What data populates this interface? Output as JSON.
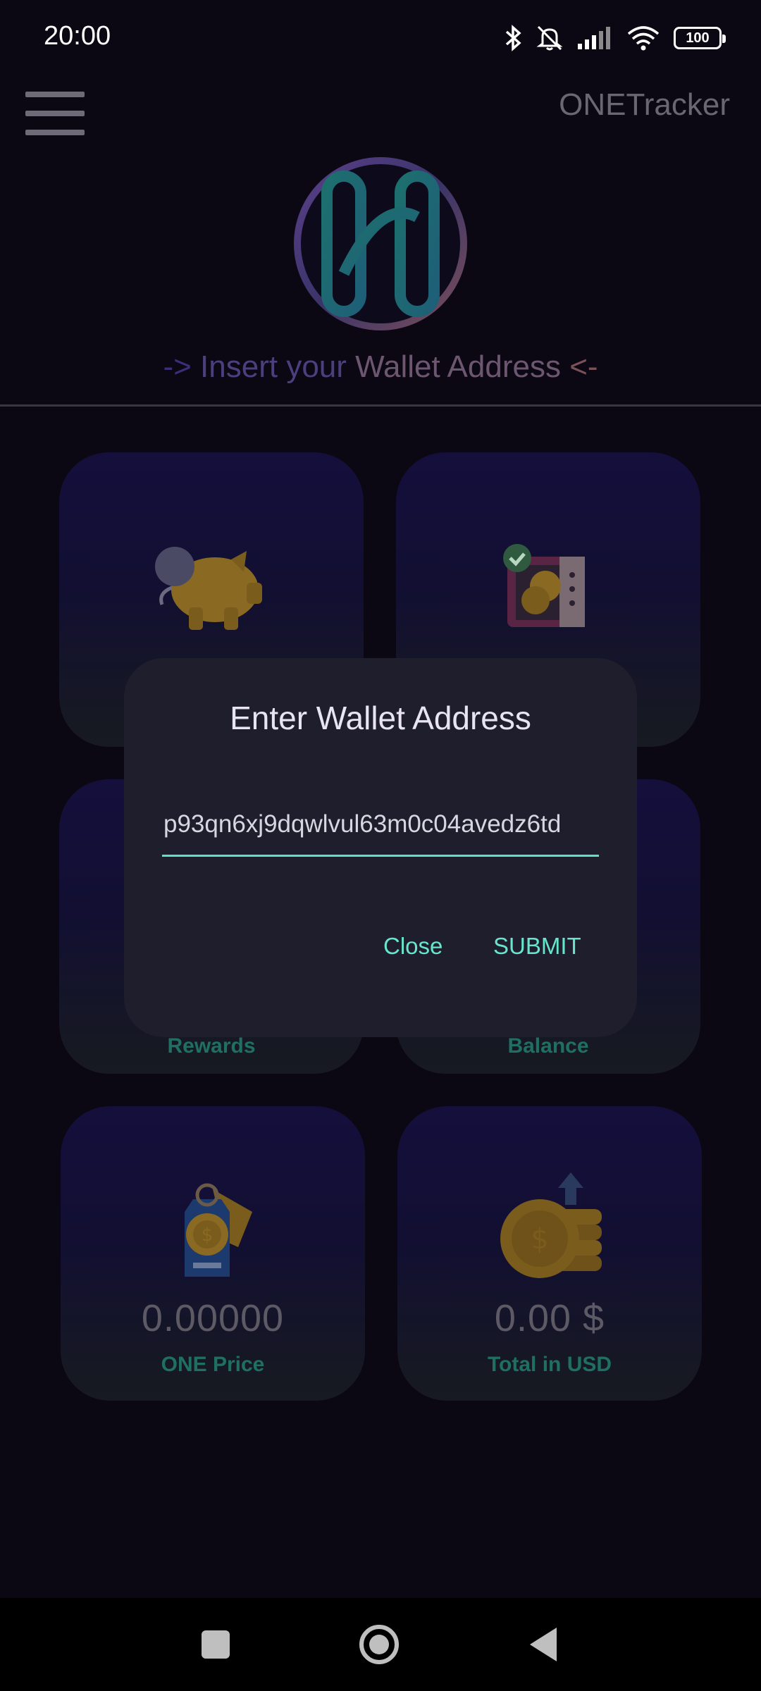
{
  "status_bar": {
    "time": "20:00",
    "battery": "100",
    "icons": [
      "bluetooth-icon",
      "bell-muted-icon",
      "signal-icon",
      "wifi-icon",
      "battery-icon"
    ]
  },
  "header": {
    "title": "ONETracker",
    "menu_icon": "hamburger-menu-icon"
  },
  "hint": {
    "arrow_left": "->",
    "insert": "Insert",
    "your": "your",
    "wallet_address": "Wallet Address",
    "arrow_right": "<-"
  },
  "cards": [
    {
      "icon": "piggy-bank-icon",
      "label": ""
    },
    {
      "icon": "safe-coins-icon",
      "label": ""
    },
    {
      "icon": "",
      "label": "Rewards"
    },
    {
      "icon": "",
      "label": "Balance"
    },
    {
      "icon": "price-tag-icon",
      "value": "0.00000",
      "label": "ONE Price"
    },
    {
      "icon": "coin-stack-icon",
      "value": "0.00 $",
      "label": "Total in USD"
    }
  ],
  "dialog": {
    "title": "Enter Wallet Address",
    "input_value": "p93qn6xj9dqwlvul63m0c04avedz6td",
    "close_label": "Close",
    "submit_label": "SUBMIT"
  },
  "nav_bar": {
    "icons": [
      "recents-square-icon",
      "home-circle-icon",
      "back-triangle-icon"
    ]
  },
  "colors": {
    "background": "#0b0713",
    "dialog": "#1e1e2c",
    "accent": "#67e6cc"
  }
}
